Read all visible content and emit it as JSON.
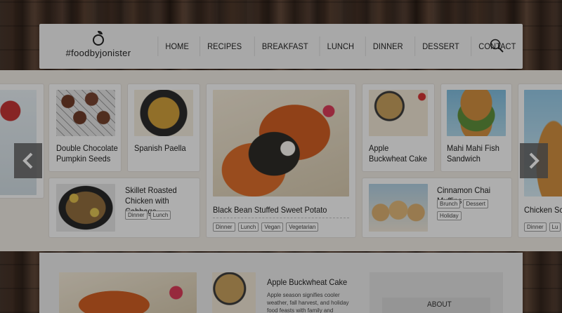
{
  "site": {
    "logo_text": "#foodbyjonister",
    "nav": [
      "HOME",
      "RECIPES",
      "BREAKFAST",
      "LUNCH",
      "DINNER",
      "DESSERT",
      "CONTACT"
    ]
  },
  "slider": {
    "cards": [
      {
        "title": "Double Chocolate Pumpkin Seeds",
        "tags": []
      },
      {
        "title": "Spanish Paella",
        "tags": []
      },
      {
        "title": "Skillet Roasted Chicken with Cabbage",
        "tags": [
          "Dinner",
          "Lunch"
        ]
      },
      {
        "title": "Black Bean Stuffed Sweet Potato",
        "tags": [
          "Dinner",
          "Lunch",
          "Vegan",
          "Vegetarian"
        ]
      },
      {
        "title": "Apple Buckwheat Cake",
        "tags": []
      },
      {
        "title": "Mahi Mahi Fish Sandwich",
        "tags": []
      },
      {
        "title": "Cinnamon Chai Muffins",
        "tags": [
          "Brunch",
          "Dessert",
          "Holiday"
        ]
      },
      {
        "title": "Chicken Schn",
        "tags": [
          "Dinner",
          "Lu"
        ]
      }
    ]
  },
  "featured": {
    "title": "Apple Buckwheat Cake",
    "excerpt": "Apple season signifies cooler weather, fall harvest, and holiday food feasts with family and friends!"
  },
  "sidebar": {
    "about_label": "ABOUT"
  },
  "icons": {
    "search": "search-icon",
    "prev": "chevron-left-icon",
    "next": "chevron-right-icon",
    "logo": "apple-icon"
  }
}
